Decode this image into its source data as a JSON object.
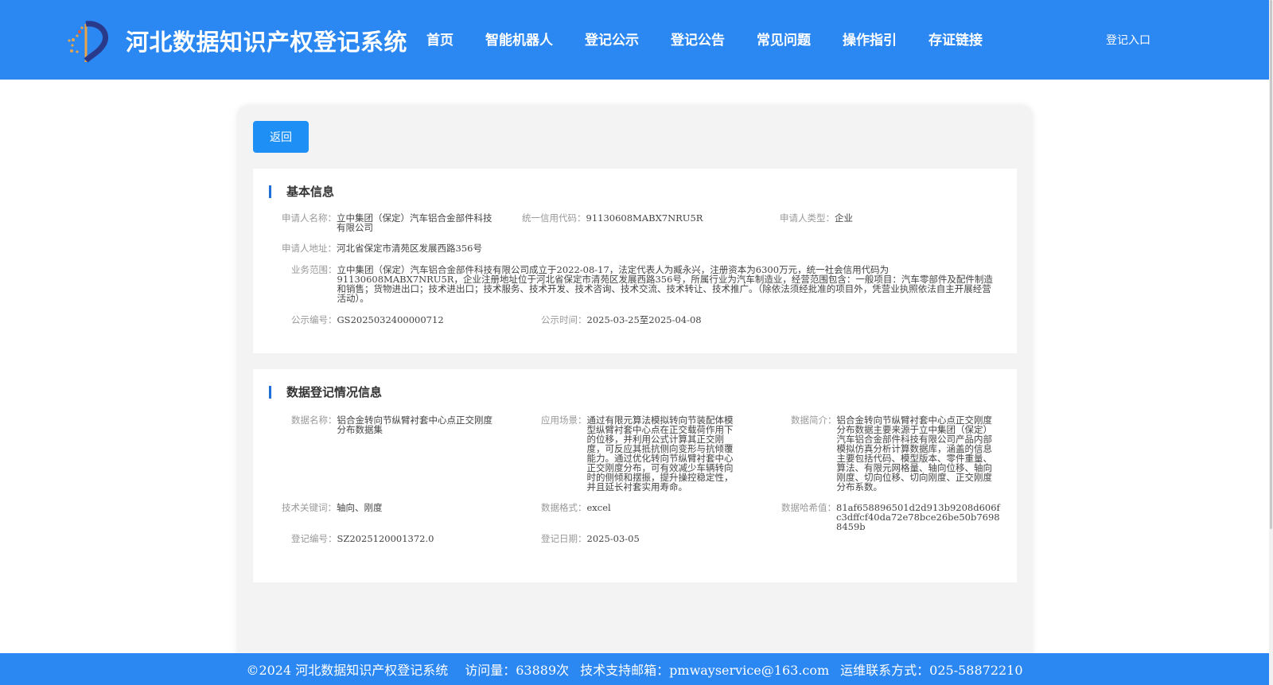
{
  "header": {
    "title": "河北数据知识产权登记系统",
    "nav": [
      "首页",
      "智能机器人",
      "登记公示",
      "登记公告",
      "常见问题",
      "操作指引",
      "存证链接"
    ],
    "login": "登记入口"
  },
  "back_label": "返回",
  "basic": {
    "title": "基本信息",
    "applicant_name_label": "申请人名称：",
    "applicant_name": "立中集团（保定）汽车铝合金部件科技有限公司",
    "credit_code_label": "统一信用代码：",
    "credit_code": "91130608MABX7NRU5R",
    "applicant_type_label": "申请人类型：",
    "applicant_type": "企业",
    "address_label": "申请人地址：",
    "address": "河北省保定市清苑区发展西路356号",
    "scope_label": "业务范围：",
    "scope": "立中集团（保定）汽车铝合金部件科技有限公司成立于2022-08-17，法定代表人为臧永兴，注册资本为6300万元，统一社会信用代码为91130608MABX7NRU5R，企业注册地址位于河北省保定市清苑区发展西路356号，所属行业为汽车制造业，经营范围包含：一般项目：汽车零部件及配件制造和销售；货物进出口；技术进出口；技术服务、技术开发、技术咨询、技术交流、技术转让、技术推广。（除依法须经批准的项目外，凭营业执照依法自主开展经营活动）。",
    "pub_no_label": "公示编号：",
    "pub_no": "GS2025032400000712",
    "pub_time_label": "公示时间：",
    "pub_time": "2025-03-25至2025-04-08"
  },
  "registration": {
    "title": "数据登记情况信息",
    "data_name_label": "数据名称：",
    "data_name": "铝合金转向节纵臂衬套中心点正交刚度分布数据集",
    "scenario_label": "应用场景：",
    "scenario": "通过有限元算法模拟转向节装配体模型纵臂衬套中心点在正交载荷作用下的位移，并利用公式计算其正交刚度，可反应其抵抗侧向变形与抗倾覆能力。通过优化转向节纵臂衬套中心正交刚度分布，可有效减少车辆转向时的侧倾和摆振，提升操控稳定性，并且延长衬套实用寿命。",
    "summary_label": "数据简介：",
    "summary": "铝合金转向节纵臂衬套中心点正交刚度分布数据主要来源于立中集团（保定）汽车铝合金部件科技有限公司产品内部模拟仿真分析计算数据库，涵盖的信息主要包括代码、模型版本、零件重量、算法、有限元网格量、轴向位移、轴向刚度、切向位移、切向刚度、正交刚度分布系数。",
    "keywords_label": "技术关键词：",
    "keywords": "轴向、刚度",
    "format_label": "数据格式：",
    "format": "excel",
    "hash_label": "数据哈希值：",
    "hash": "81af658896501d2d913b9208d606fc3dffcf40da72e78bce26be50b76988459b",
    "reg_no_label": "登记编号：",
    "reg_no": "SZ2025120001372.0",
    "reg_date_label": "登记日期：",
    "reg_date": "2025-03-05"
  },
  "footer": {
    "copyright": "©2024 河北数据知识产权登记系统",
    "visits": "访问量：63889次",
    "email": "技术支持邮箱：pmwayservice@163.com",
    "phone": "运维联系方式：025-58872210"
  }
}
